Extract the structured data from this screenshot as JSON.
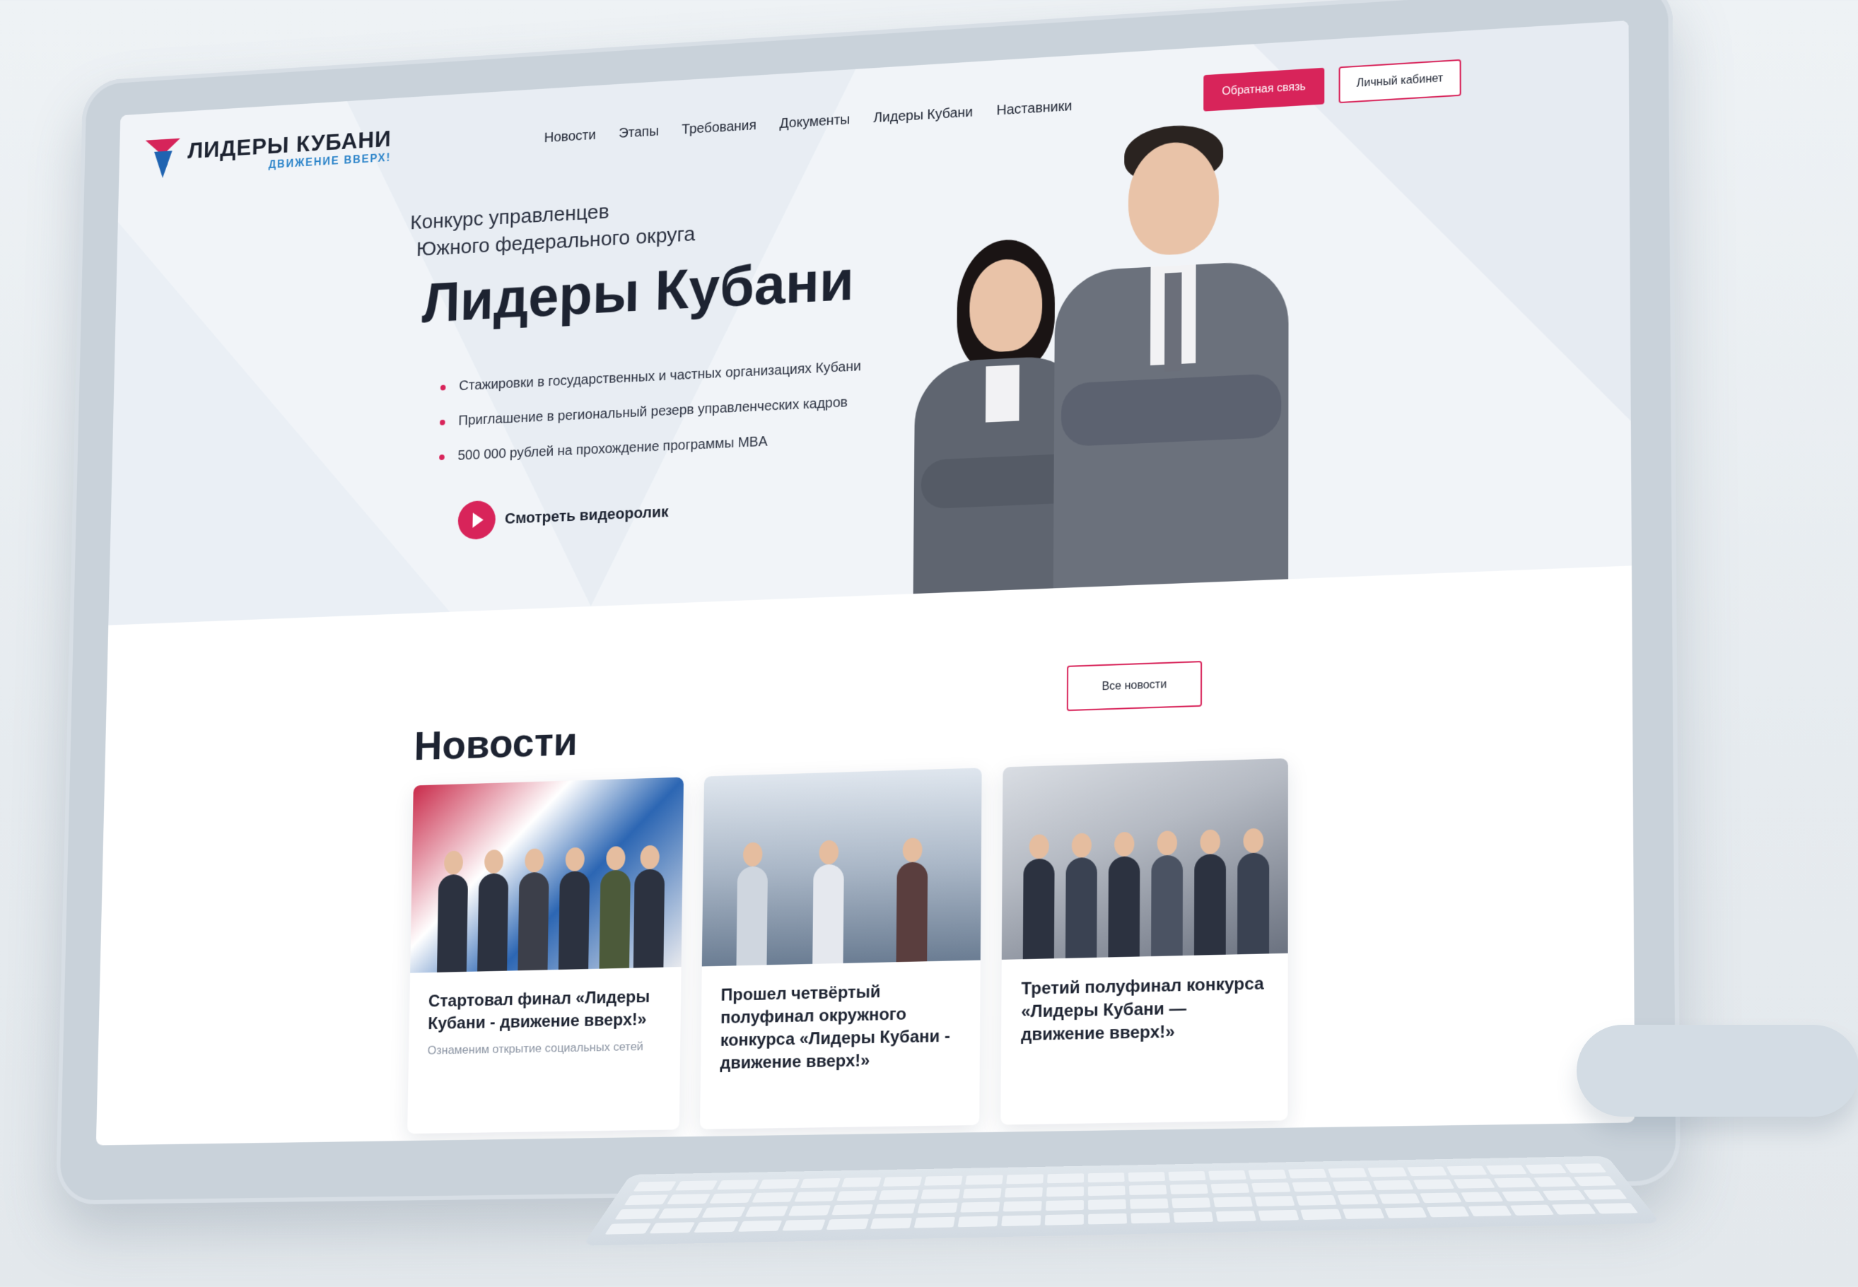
{
  "logo": {
    "title": "ЛИДЕРЫ КУБАНИ",
    "tagline": "ДВИЖЕНИЕ ВВЕРХ!"
  },
  "nav": [
    {
      "label": "Новости"
    },
    {
      "label": "Этапы"
    },
    {
      "label": "Требования"
    },
    {
      "label": "Документы"
    },
    {
      "label": "Лидеры Кубани"
    },
    {
      "label": "Наставники"
    }
  ],
  "header_buttons": {
    "feedback": "Обратная связь",
    "cabinet": "Личный кабинет"
  },
  "hero": {
    "subtitle_line1": "Конкурс управленцев",
    "subtitle_line2": "Южного федерального округа",
    "title": "Лидеры Кубани",
    "bullets": [
      "Стажировки в государственных и частных организациях Кубани",
      "Приглашение в региональный резерв управленческих кадров",
      "500 000 рублей на прохождение программы MBA"
    ],
    "video_label": "Смотреть видеоролик"
  },
  "news": {
    "title": "Новости",
    "all_button": "Все новости",
    "cards": [
      {
        "title": "Стартовал финал «Лидеры Кубани - движение вверх!»",
        "excerpt": "Ознаменим открытие социальных сетей"
      },
      {
        "title": "Прошел четвёртый полуфинал окружного конкурса «Лидеры Кубани - движение вверх!»",
        "excerpt": ""
      },
      {
        "title": "Третий полуфинал конкурса «Лидеры Кубани — движение вверх!»",
        "excerpt": ""
      }
    ]
  },
  "colors": {
    "accent": "#d8245a",
    "brand_blue": "#1f63b1",
    "text": "#1d2331"
  }
}
